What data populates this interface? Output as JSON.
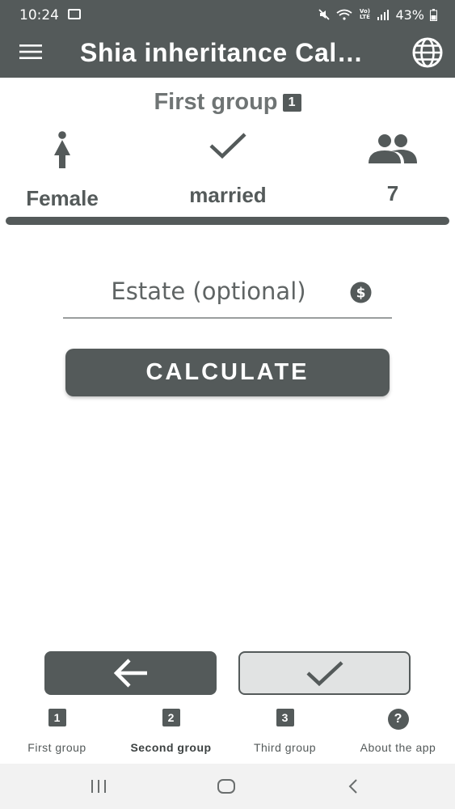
{
  "status_bar": {
    "time": "10:24",
    "battery": "43%",
    "lte": "Vo) LTE",
    "signal_small": "6"
  },
  "app_bar": {
    "title": "Shia inheritance Cal…",
    "icons": [
      "menu-icon",
      "globe-icon"
    ]
  },
  "group": {
    "title": "First group",
    "badge": "1"
  },
  "summary": [
    {
      "label": "Female",
      "icon": "female-icon"
    },
    {
      "label": "married",
      "icon": "check-icon"
    },
    {
      "label": "7",
      "icon": "people-icon"
    }
  ],
  "estate": {
    "placeholder": "Estate (optional)",
    "value": "",
    "icon": "dollar-icon"
  },
  "calculate": {
    "label": "CALCULATE"
  },
  "navigation": {
    "back_icon": "arrow-left-icon",
    "next_icon": "check-icon"
  },
  "bottom_nav": [
    {
      "badge": "1",
      "label": "First group",
      "active": false
    },
    {
      "badge": "2",
      "label": "Second group",
      "active": true
    },
    {
      "badge": "3",
      "label": "Third group",
      "active": false
    },
    {
      "badge": "?",
      "label": "About the app",
      "active": false
    }
  ],
  "colors": {
    "primary": "#545a5a",
    "background": "#ffffff",
    "secondary_button": "#e1e3e3"
  }
}
